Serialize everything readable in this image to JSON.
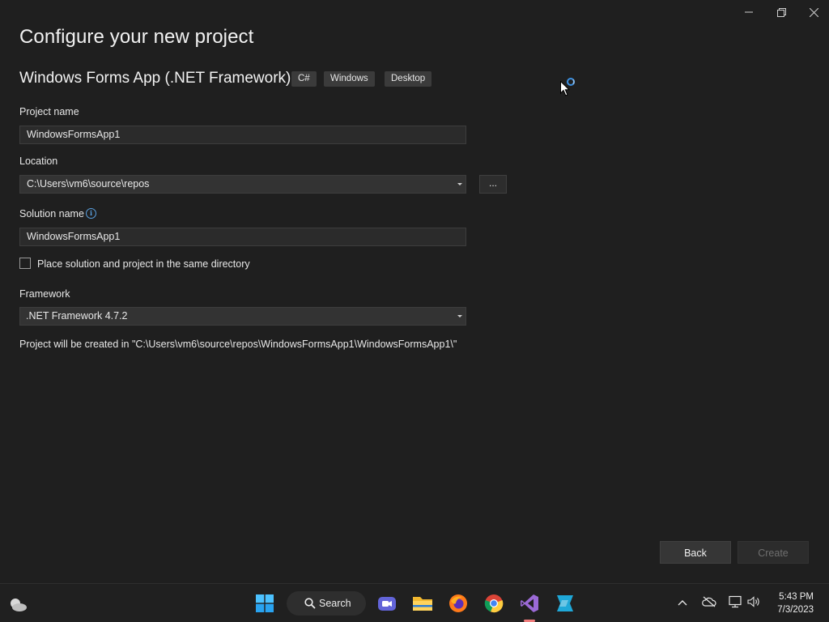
{
  "window": {
    "controls": {
      "minimize": "—",
      "restore": "❐",
      "close": "✕"
    },
    "title": "Configure your new project",
    "template_name": "Windows Forms App (.NET Framework)",
    "tags": [
      "C#",
      "Windows",
      "Desktop"
    ]
  },
  "form": {
    "project_name": {
      "label": "Project name",
      "value": "WindowsFormsApp1"
    },
    "location": {
      "label": "Location",
      "value": "C:\\Users\\vm6\\source\\repos",
      "browse_label": "..."
    },
    "solution_name": {
      "label": "Solution name",
      "value": "WindowsFormsApp1",
      "info_glyph": "i"
    },
    "same_directory": {
      "label": "Place solution and project in the same directory",
      "checked": false
    },
    "framework": {
      "label": "Framework",
      "value": ".NET Framework 4.7.2"
    },
    "path_note": "Project will be created in \"C:\\Users\\vm6\\source\\repos\\WindowsFormsApp1\\WindowsFormsApp1\\\""
  },
  "footer": {
    "back_label": "Back",
    "create_label": "Create"
  },
  "taskbar": {
    "search_label": "Search",
    "apps": [
      "windows-start-icon",
      "teams-icon",
      "file-explorer-icon",
      "firefox-icon",
      "chrome-icon",
      "visual-studio-icon",
      "vs-installer-icon"
    ],
    "time": "5:43 PM",
    "date": "7/3/2023"
  },
  "colors": {
    "accent": "#3b8fe0",
    "background": "#1f1f1f",
    "taskbar": "#202020"
  }
}
